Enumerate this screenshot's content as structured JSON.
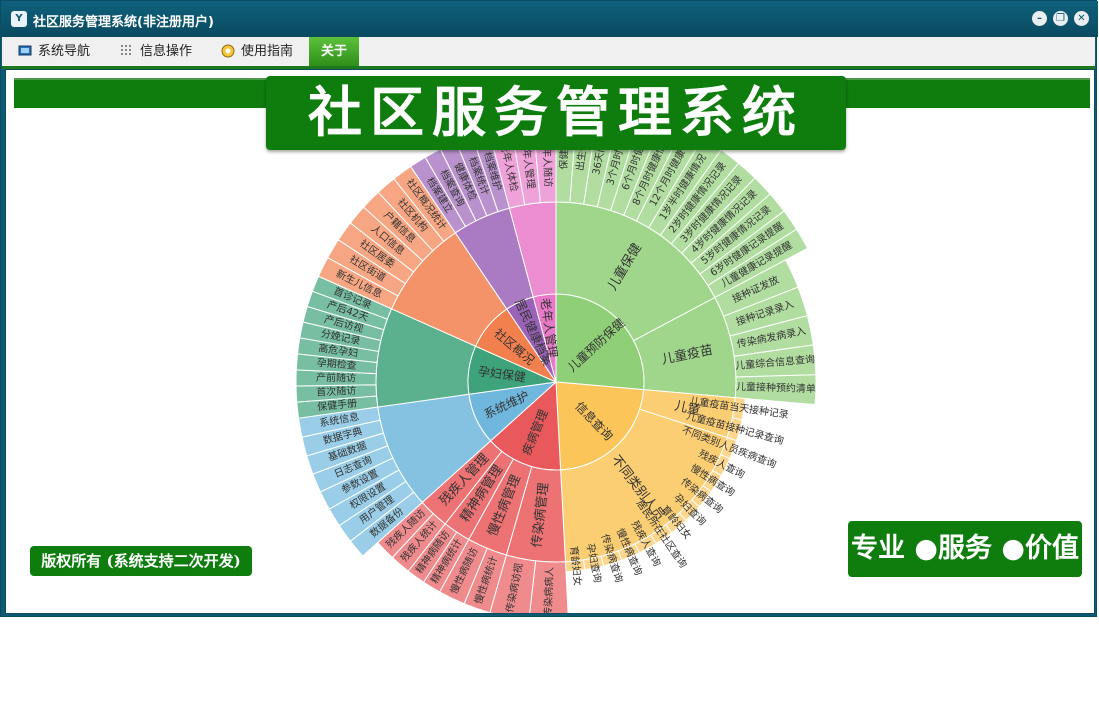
{
  "window": {
    "title": "社区服务管理系统(非注册用户)"
  },
  "menu": [
    {
      "label": "系统导航",
      "icon": "monitor-icon"
    },
    {
      "label": "信息操作",
      "icon": "grid-icon"
    },
    {
      "label": "使用指南",
      "icon": "guide-icon"
    },
    {
      "label": "关于",
      "icon": "",
      "active": true
    }
  ],
  "banner": "社区服务管理系统",
  "copyright": "版权所有 (系统支持二次开发)",
  "slogan": "专业 ●服务 ●价值",
  "colors": {
    "titlebar": "#0e5a72",
    "green": "#0e7d0e",
    "children": "#8fcf78",
    "info": "#fbc55a",
    "disease": "#e9595c",
    "system": "#6fb7dc",
    "maternal": "#3ea27a",
    "community": "#f2804e",
    "resident": "#9b63b7",
    "elder": "#e879c8"
  },
  "chart_data": {
    "type": "sunburst",
    "inner_label": "",
    "sectors": [
      {
        "name": "儿童预防保健",
        "color": "#8fcf78",
        "start": 0,
        "end": 95,
        "children": [
          {
            "name": "儿童保健",
            "start": 0,
            "end": 62,
            "leaves": [
              "保健手册",
              "出生情况",
              "36天问询",
              "3个月时健康",
              "6个月时健康",
              "8个月时健康情况",
              "12个月时健康",
              "1岁半时健康情况",
              "2岁时健康情况记录",
              "3岁时健康情况记录",
              "4岁时健康情况记录",
              "5岁时健康情况记录",
              "6岁时健康记录提醒",
              "儿童健康记录提醒"
            ]
          },
          {
            "name": "儿童疫苗",
            "start": 62,
            "end": 95,
            "leaves": [
              "接种证发放",
              "接种记录录入",
              "传染病发病录入",
              "儿童综合信息查询",
              "儿童接种预约清单"
            ]
          }
        ]
      },
      {
        "name": "信息查询",
        "color": "#fbc55a",
        "start": 95,
        "end": 177,
        "children": [
          {
            "name": "儿童",
            "start": 95,
            "end": 108,
            "leaves": [
              "儿童疫苗当天接种记录",
              "儿童疫苗接种记录查询"
            ]
          },
          {
            "name": "不同类别人员",
            "start": 108,
            "end": 177,
            "leaves": [
              "不同类别人员疾病查询",
              "残疾人查询",
              "慢性病查询",
              "传染病查询",
              "孕妇查询",
              "育龄妇女",
              "居民所在社区查询",
              "残疾人查询",
              "慢性病查询",
              "传染病查询",
              "孕妇查询",
              "育龄妇女"
            ]
          }
        ]
      },
      {
        "name": "疾病管理",
        "color": "#e9595c",
        "start": 177,
        "end": 228,
        "children": [
          {
            "name": "传染病管理",
            "start": 177,
            "end": 196,
            "leaves": [
              "传染病病人",
              "传染病访视"
            ]
          },
          {
            "name": "慢性病管理",
            "start": 196,
            "end": 209,
            "leaves": [
              "慢性病统计",
              "慢性病随访"
            ]
          },
          {
            "name": "精神病管理",
            "start": 209,
            "end": 218,
            "leaves": [
              "精神病统计",
              "精神病随访"
            ]
          },
          {
            "name": "残疾人管理",
            "start": 218,
            "end": 228,
            "leaves": [
              "残疾人统计",
              "残疾人随访"
            ]
          }
        ]
      },
      {
        "name": "系统维护",
        "color": "#6fb7dc",
        "start": 228,
        "end": 262,
        "children": [
          {
            "name": "",
            "start": 228,
            "end": 262,
            "leaves": [
              "数据备份",
              "用户管理",
              "权限设置",
              "参数设置",
              "日志查询",
              "基础数据",
              "数据字典",
              "系统信息"
            ]
          }
        ]
      },
      {
        "name": "孕妇保健",
        "color": "#3ea27a",
        "start": 262,
        "end": 294,
        "children": [
          {
            "name": "",
            "start": 262,
            "end": 294,
            "leaves": [
              "保健手册",
              "首次随访",
              "产前随访",
              "孕期检查",
              "高危孕妇",
              "分娩记录",
              "产后访视",
              "产后42天",
              "首诊记录"
            ]
          }
        ]
      },
      {
        "name": "社区概况",
        "color": "#f2804e",
        "start": 294,
        "end": 326,
        "children": [
          {
            "name": "",
            "start": 294,
            "end": 326,
            "leaves": [
              "新生儿信息",
              "社区街道",
              "社区居委",
              "人口信息",
              "户籍信息",
              "社区机构",
              "社区概况统计"
            ]
          }
        ]
      },
      {
        "name": "居民健康档案",
        "color": "#9b63b7",
        "start": 326,
        "end": 345,
        "children": [
          {
            "name": "",
            "start": 326,
            "end": 345,
            "leaves": [
              "档案建立",
              "档案查询",
              "健康体检",
              "档案统计",
              "档案维护"
            ]
          }
        ]
      },
      {
        "name": "老年人管理",
        "color": "#e879c8",
        "start": 345,
        "end": 360,
        "children": [
          {
            "name": "",
            "start": 345,
            "end": 360,
            "leaves": [
              "老年人体检",
              "老年人管理",
              "老年人随访"
            ]
          }
        ]
      }
    ]
  }
}
